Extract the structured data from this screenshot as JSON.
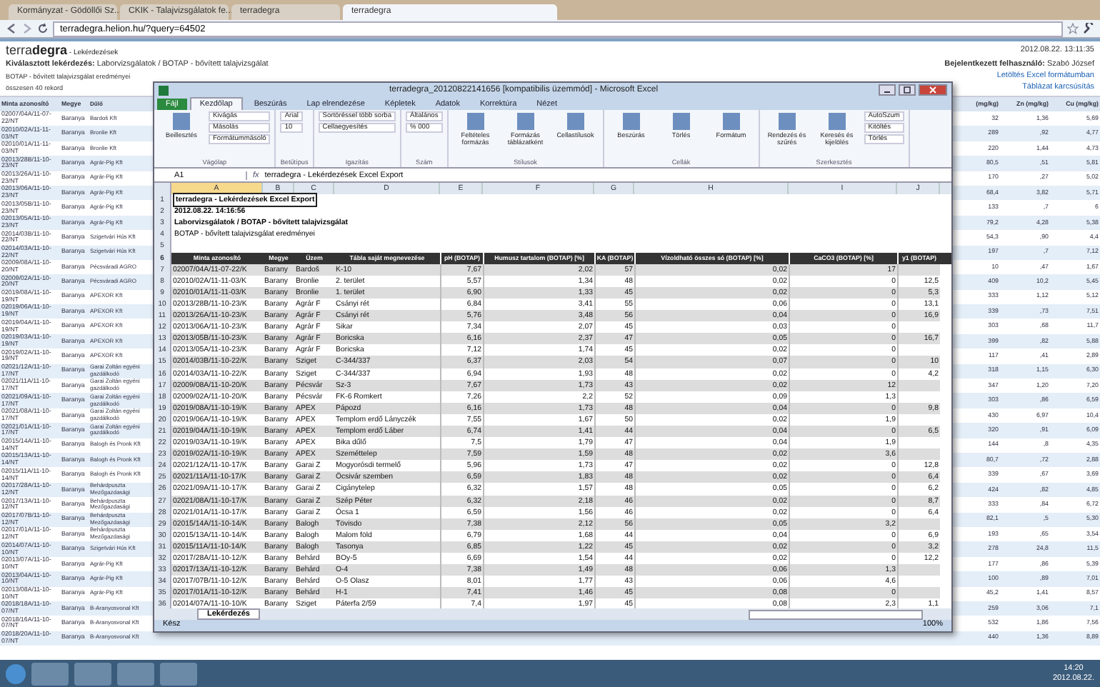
{
  "browser": {
    "tabs": [
      {
        "label": "Kormányzat - Gödöllői Sz...",
        "selected": false
      },
      {
        "label": "CKIK - Talajvizsgálatok fe...",
        "selected": false
      },
      {
        "label": "terradegra",
        "selected": false
      },
      {
        "label": "terradegra",
        "selected": true
      }
    ],
    "url": "terradegra.helion.hu/?query=64502"
  },
  "page": {
    "brand_light": "terra",
    "brand_bold": "degra",
    "section": " - Lekérdezések",
    "datetime": "2012.08.22.   13:11:35",
    "query_label": "Kiválasztott lekérdezés:",
    "query": "Laborvizsgálatok / BOTAP - bővített talajvizsgálat",
    "user_label": "Bejelentkezett felhasználó:",
    "user": "Szabó József",
    "subtitle": "BOTAP - bővített talajvizsgálat eredményei",
    "count": "összesen 40 rekord",
    "download_link": "Letöltés Excel formátumban",
    "slim_link": "Táblázat karcsúsítás",
    "columns": [
      "Minta azonosító",
      "Megye",
      "Dűlő",
      "(mg/kg)",
      "Zn (mg/kg)",
      "Cu (mg/kg)"
    ],
    "rows": [
      [
        "02007/04A/11-07-22/NT",
        "Baranya",
        "Bardoš Kft",
        "32",
        "1,36",
        "5,69"
      ],
      [
        "02010/02A/11-11-03/NT",
        "Baranya",
        "Bronlie Kft",
        "289",
        ",92",
        "4,77"
      ],
      [
        "02010/01A/11-11-03/NT",
        "Baranya",
        "Bronlie Kft",
        "220",
        "1,44",
        "4,73"
      ],
      [
        "02013/28B/11-10-23/NT",
        "Baranya",
        "Agrár-Pig Kft",
        "80,5",
        ",51",
        "5,81"
      ],
      [
        "02013/26A/11-10-23/NT",
        "Baranya",
        "Agrár-Pig Kft",
        "170",
        ",27",
        "5,02"
      ],
      [
        "02013/06A/11-10-23/NT",
        "Baranya",
        "Agrár-Pig Kft",
        "68,4",
        "3,82",
        "5,71"
      ],
      [
        "02013/05B/11-10-23/NT",
        "Baranya",
        "Agrár-Pig Kft",
        "133",
        ",7",
        "6"
      ],
      [
        "02013/05A/11-10-23/NT",
        "Baranya",
        "Agrár-Pig Kft",
        "79,2",
        "4,28",
        "5,38"
      ],
      [
        "02014/03B/11-10-22/NT",
        "Baranya",
        "Szigetvári Hús Kft",
        "54,3",
        ",90",
        "4,4"
      ],
      [
        "02014/03A/11-10-22/NT",
        "Baranya",
        "Szigetvári Hús Kft",
        "197",
        ",7",
        "7,12"
      ],
      [
        "02009/08A/11-10-20/NT",
        "Baranya",
        "Pécsváradi AGRO",
        "10",
        ",47",
        "1,67"
      ],
      [
        "02009/02A/11-10-20/NT",
        "Baranya",
        "Pécsváradi AGRO",
        "409",
        "10,2",
        "5,45"
      ],
      [
        "02019/08A/11-10-19/NT",
        "Baranya",
        "APEXOR Kft",
        "333",
        "1,12",
        "5,12"
      ],
      [
        "02019/06A/11-10-19/NT",
        "Baranya",
        "APEXOR Kft",
        "339",
        ",73",
        "7,51"
      ],
      [
        "02019/04A/11-10-19/NT",
        "Baranya",
        "APEXOR Kft",
        "303",
        ",68",
        "11,7"
      ],
      [
        "02019/03A/11-10-19/NT",
        "Baranya",
        "APEXOR Kft",
        "399",
        ",82",
        "5,88"
      ],
      [
        "02019/02A/11-10-19/NT",
        "Baranya",
        "APEXOR Kft",
        "117",
        ",41",
        "2,89"
      ],
      [
        "02021/12A/11-10-17/NT",
        "Baranya",
        "Garai Zoltán egyéni gazdálkodó",
        "318",
        "1,15",
        "6,30"
      ],
      [
        "02021/11A/11-10-17/NT",
        "Baranya",
        "Garai Zoltán egyéni gazdálkodó",
        "347",
        "1,20",
        "7,20"
      ],
      [
        "02021/09A/11-10-17/NT",
        "Baranya",
        "Garai Zoltán egyéni gazdálkodó",
        "303",
        ",86",
        "6,59"
      ],
      [
        "02021/08A/11-10-17/NT",
        "Baranya",
        "Garai Zoltán egyéni gazdálkodó",
        "430",
        "6,97",
        "10,4"
      ],
      [
        "02021/01A/11-10-17/NT",
        "Baranya",
        "Garai Zoltán egyéni gazdálkodó",
        "320",
        ",91",
        "6,09"
      ],
      [
        "02015/14A/11-10-14/NT",
        "Baranya",
        "Balogh és Pronk Kft",
        "144",
        ",8",
        "4,35"
      ],
      [
        "02015/13A/11-10-14/NT",
        "Baranya",
        "Balogh és Pronk Kft",
        "80,7",
        ",72",
        "2,88"
      ],
      [
        "02015/11A/11-10-14/NT",
        "Baranya",
        "Balogh és Pronk Kft",
        "339",
        ",67",
        "3,69"
      ],
      [
        "02017/28A/11-10-12/NT",
        "Baranya",
        "Behárdpuszta Mezőgazdasági",
        "424",
        ",82",
        "4,85"
      ],
      [
        "02017/13A/11-10-12/NT",
        "Baranya",
        "Behárdpuszta Mezőgazdasági",
        "333",
        ",84",
        "6,72"
      ],
      [
        "02017/07B/11-10-12/NT",
        "Baranya",
        "Behárdpuszta Mezőgazdasági",
        "82,1",
        ",5",
        "5,30"
      ],
      [
        "02017/01A/11-10-12/NT",
        "Baranya",
        "Behárdpuszta Mezőgazdasági",
        "193",
        ",65",
        "3,54"
      ],
      [
        "02014/07A/11-10-10/NT",
        "Baranya",
        "Szigetvári Hús Kft",
        "278",
        "24,8",
        "11,5"
      ],
      [
        "02013/07A/11-10-10/NT",
        "Baranya",
        "Agrár-Pig Kft",
        "177",
        ",86",
        "5,39"
      ],
      [
        "02013/04A/11-10-10/NT",
        "Baranya",
        "Agrár-Pig Kft",
        "100",
        ",89",
        "7,01"
      ],
      [
        "02013/08A/11-10-10/NT",
        "Baranya",
        "Agrár-Pig Kft",
        "45,2",
        "1,41",
        "8,57"
      ],
      [
        "02018/18A/11-10-07/NT",
        "Baranya",
        "B-Aranyosvonal Kft",
        "259",
        "3,06",
        "7,1"
      ],
      [
        "02018/16A/11-10-07/NT",
        "Baranya",
        "B-Aranyosvonal Kft",
        "532",
        "1,86",
        "7,56"
      ],
      [
        "02018/20A/11-10-07/NT",
        "Baranya",
        "B-Aranyosvonal Kft",
        "440",
        "1,36",
        "8,89"
      ]
    ]
  },
  "excel": {
    "title": "terradegra_20120822141656  [kompatibilis üzemmód]  -  Microsoft Excel",
    "ribbon_tabs": [
      {
        "label": "Fájl",
        "selected": false,
        "kind": "file"
      },
      {
        "label": "Kezdőlap",
        "selected": true,
        "kind": "tab"
      },
      {
        "label": "Beszúrás",
        "selected": false,
        "kind": "tab"
      },
      {
        "label": "Lap elrendezése",
        "selected": false,
        "kind": "tab"
      },
      {
        "label": "Képletek",
        "selected": false,
        "kind": "tab"
      },
      {
        "label": "Adatok",
        "selected": false,
        "kind": "tab"
      },
      {
        "label": "Korrektúra",
        "selected": false,
        "kind": "tab"
      },
      {
        "label": "Nézet",
        "selected": false,
        "kind": "tab"
      }
    ],
    "groups": [
      {
        "name": "Vágólap",
        "big": [
          "Beillesztés"
        ],
        "small": [
          "Kivágás",
          "Másolás",
          "Formátummásoló"
        ]
      },
      {
        "name": "Betűtípus",
        "small": [
          "Arial",
          "10"
        ]
      },
      {
        "name": "Igazítás",
        "small": [
          "Sortöréssel több sorba",
          "Cellaegyesítés"
        ]
      },
      {
        "name": "Szám",
        "small": [
          "Általános",
          "%  000"
        ]
      },
      {
        "name": "Stílusok",
        "big": [
          "Feltételes formázás",
          "Formázás táblázatként",
          "Cellastílusok"
        ]
      },
      {
        "name": "Cellák",
        "big": [
          "Beszúrás",
          "Törlés",
          "Formátum"
        ]
      },
      {
        "name": "Szerkesztés",
        "big": [
          "Rendezés és szűrés",
          "Keresés és kijelölés"
        ],
        "small": [
          "AutoSzum",
          "Kitöltés",
          "Törlés"
        ]
      }
    ],
    "name_box": "A1",
    "fx_label": "fx",
    "formula": "terradegra - Lekérdezések Excel Export",
    "row_numbers": [
      "1",
      "2",
      "3",
      "4",
      "5",
      "6",
      "7",
      "8",
      "9",
      "10",
      "11",
      "12",
      "13",
      "14",
      "15",
      "16",
      "17",
      "18",
      "19",
      "20",
      "21",
      "22",
      "23",
      "24",
      "25",
      "26",
      "27",
      "28",
      "29",
      "30",
      "31",
      "32",
      "33",
      "34",
      "35",
      "36"
    ],
    "col_letters": [
      "A",
      "B",
      "C",
      "D",
      "E",
      "F",
      "G",
      "H",
      "I",
      "J"
    ],
    "top_rows": [
      {
        "text": "terradegra - Lekérdezések Excel Export",
        "bold": true
      },
      {
        "text": "2012.08.22. 14:16:56",
        "bold": true
      },
      {
        "text": "Laborvizsgálatok / BOTAP - bővített talajvizsgálat",
        "bold": true
      },
      {
        "text": "BOTAP - bővített talajvizsgálat eredményei",
        "bold": false
      }
    ],
    "header": [
      "Minta azonosító",
      "Megye",
      "Üzem",
      "Tábla saját megnevezése",
      "pH (BOTAP)",
      "Humusz tartalom (BOTAP) [%]",
      "KA (BOTAP)",
      "Vízoldható összes só (BOTAP) [%]",
      "CaCO3 (BOTAP) [%]",
      "y1 (BOTAP)"
    ],
    "rows": [
      [
        "02007/04A/11-07-22/K",
        "Barany",
        "Bardoš",
        "K-10",
        "7,67",
        "2,02",
        "57",
        "0,02",
        "17",
        ""
      ],
      [
        "02010/02A/11-11-03/K",
        "Barany",
        "Bronlie",
        "2. terület",
        "5,57",
        "1,34",
        "48",
        "0,02",
        "0",
        "12,5"
      ],
      [
        "02010/01A/11-11-03/K",
        "Barany",
        "Bronlie",
        "1. terület",
        "6,90",
        "1,33",
        "45",
        "0,02",
        "0",
        "5,3"
      ],
      [
        "02013/28B/11-10-23/K",
        "Barany",
        "Agrár F",
        "Csányi rét",
        "6,84",
        "3,41",
        "55",
        "0,06",
        "0",
        "13,1"
      ],
      [
        "02013/26A/11-10-23/K",
        "Barany",
        "Agrár F",
        "Csányi rét",
        "5,76",
        "3,48",
        "56",
        "0,04",
        "0",
        "16,9"
      ],
      [
        "02013/06A/11-10-23/K",
        "Barany",
        "Agrár F",
        "Sikar",
        "7,34",
        "2,07",
        "45",
        "0,03",
        "0",
        ""
      ],
      [
        "02013/05B/11-10-23/K",
        "Barany",
        "Agrár F",
        "Boricska",
        "6,16",
        "2,37",
        "47",
        "0,05",
        "0",
        "16,7"
      ],
      [
        "02013/05A/11-10-23/K",
        "Barany",
        "Agrár F",
        "Boricska",
        "7,12",
        "1,74",
        "45",
        "0,02",
        "0",
        ""
      ],
      [
        "02014/03B/11-10-22/K",
        "Barany",
        "Sziget",
        "C-344/337",
        "6,37",
        "2,03",
        "54",
        "0,07",
        "0",
        "10"
      ],
      [
        "02014/03A/11-10-22/K",
        "Barany",
        "Sziget",
        "C-344/337",
        "6,94",
        "1,93",
        "48",
        "0,02",
        "0",
        "4,2"
      ],
      [
        "02009/08A/11-10-20/K",
        "Barany",
        "Pécsvár",
        "Sz-3",
        "7,67",
        "1,73",
        "43",
        "0,02",
        "12",
        ""
      ],
      [
        "02009/02A/11-10-20/K",
        "Barany",
        "Pécsvár",
        "FK-6 Romkert",
        "7,26",
        "2,2",
        "52",
        "0,09",
        "1,3",
        ""
      ],
      [
        "02019/08A/11-10-19/K",
        "Barany",
        "APEX",
        "Pápozd",
        "6,16",
        "1,73",
        "48",
        "0,04",
        "0",
        "9,8"
      ],
      [
        "02019/06A/11-10-19/K",
        "Barany",
        "APEX",
        "Templom erdő Lányczék",
        "7,55",
        "1,67",
        "50",
        "0,02",
        "1,9",
        ""
      ],
      [
        "02019/04A/11-10-19/K",
        "Barany",
        "APEX",
        "Templom erdő Láber",
        "6,74",
        "1,41",
        "44",
        "0,04",
        "0",
        "6,5"
      ],
      [
        "02019/03A/11-10-19/K",
        "Barany",
        "APEX",
        "Bika dűlő",
        "7,5",
        "1,79",
        "47",
        "0,04",
        "1,9",
        ""
      ],
      [
        "02019/02A/11-10-19/K",
        "Barany",
        "APEX",
        "Szeméttelep",
        "7,59",
        "1,59",
        "48",
        "0,02",
        "3,6",
        ""
      ],
      [
        "02021/12A/11-10-17/K",
        "Barany",
        "Garai Z",
        "Mogyorósdi termelő",
        "5,96",
        "1,73",
        "47",
        "0,02",
        "0",
        "12,8"
      ],
      [
        "02021/11A/11-10-17/K",
        "Barany",
        "Garai Z",
        "Öcsivár szemben",
        "6,59",
        "1,83",
        "48",
        "0,02",
        "0",
        "6,4"
      ],
      [
        "02021/09A/11-10-17/K",
        "Barany",
        "Garai Z",
        "Cigánytelep",
        "6,32",
        "1,57",
        "48",
        "0,05",
        "0",
        "6,2"
      ],
      [
        "02021/08A/11-10-17/K",
        "Barany",
        "Garai Z",
        "Szép Péter",
        "6,32",
        "2,18",
        "46",
        "0,02",
        "0",
        "8,7"
      ],
      [
        "02021/01A/11-10-17/K",
        "Barany",
        "Garai Z",
        "Ócsa 1",
        "6,59",
        "1,56",
        "46",
        "0,02",
        "0",
        "6,4"
      ],
      [
        "02015/14A/11-10-14/K",
        "Barany",
        "Balogh",
        "Tövisdo",
        "7,38",
        "2,12",
        "56",
        "0,05",
        "3,2",
        ""
      ],
      [
        "02015/13A/11-10-14/K",
        "Barany",
        "Balogh",
        "Malom föld",
        "6,79",
        "1,68",
        "44",
        "0,04",
        "0",
        "6,9"
      ],
      [
        "02015/11A/11-10-14/K",
        "Barany",
        "Balogh",
        "Tasonya",
        "6,85",
        "1,22",
        "45",
        "0,02",
        "0",
        "3,2"
      ],
      [
        "02017/28A/11-10-12/K",
        "Barany",
        "Behárd",
        "BOy-5",
        "6,69",
        "1,54",
        "44",
        "0,02",
        "0",
        "12,2"
      ],
      [
        "02017/13A/11-10-12/K",
        "Barany",
        "Behárd",
        "O-4",
        "7,38",
        "1,49",
        "48",
        "0,06",
        "1,3",
        ""
      ],
      [
        "02017/07B/11-10-12/K",
        "Barany",
        "Behárd",
        "O-5 Olasz",
        "8,01",
        "1,77",
        "43",
        "0,06",
        "4,6",
        ""
      ],
      [
        "02017/01A/11-10-12/K",
        "Barany",
        "Behárd",
        "H-1",
        "7,41",
        "1,46",
        "45",
        "0,08",
        "0",
        ""
      ],
      [
        "02014/07A/11-10-10/K",
        "Barany",
        "Sziget",
        "Páterfa 2/59",
        "7,4",
        "1,97",
        "45",
        "0,08",
        "2,3",
        "1,1"
      ]
    ],
    "sheet_tabs": [
      {
        "label": "Lekérdezés",
        "selected": true
      }
    ],
    "status": "Kész",
    "zoom": "100%"
  },
  "taskbar": {
    "time": "14:20",
    "date": "2012.08.22."
  }
}
